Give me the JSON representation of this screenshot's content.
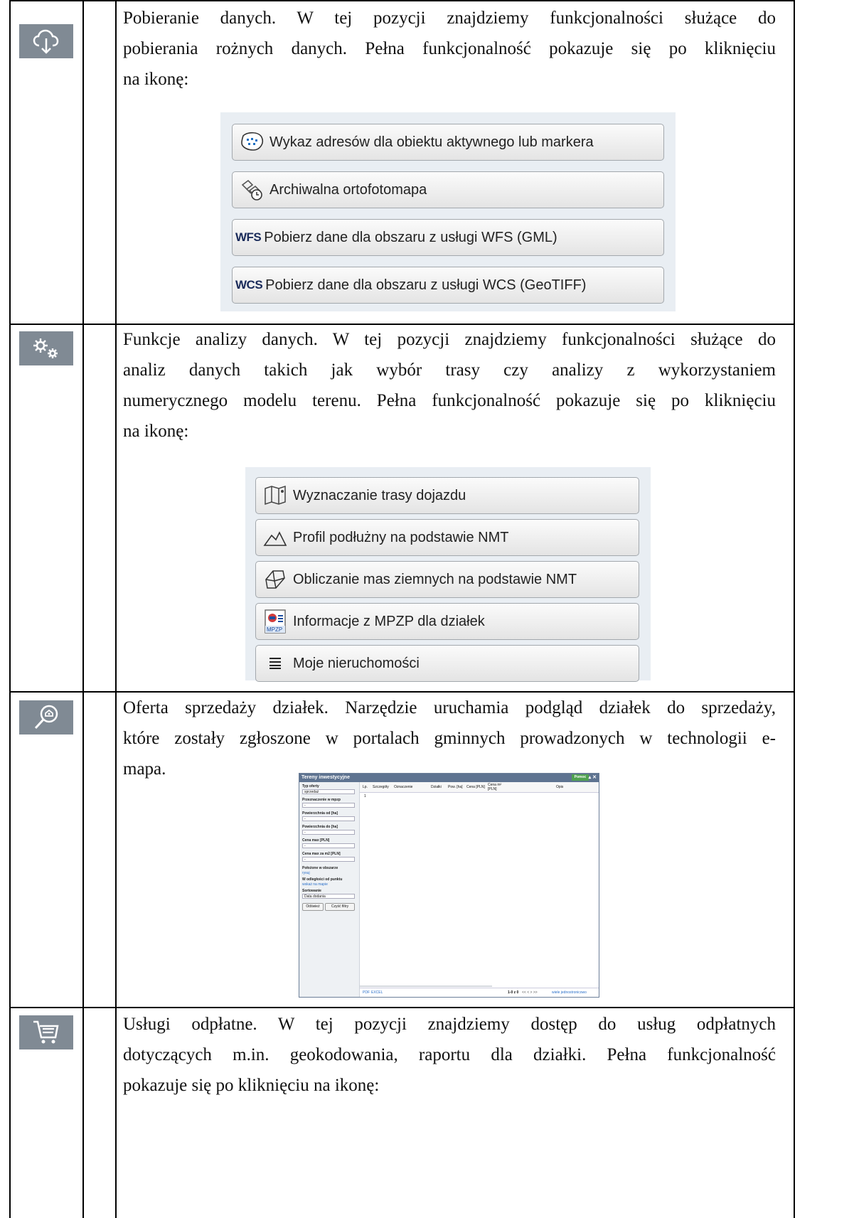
{
  "rows": [
    {
      "icon": "cloud-download-icon",
      "lines": [
        "Pobieranie danych. W tej pozycji znajdziemy funkcjonalności służące do",
        "pobierania rożnych danych. Pełna funkcjonalność pokazuje się po kliknięciu",
        "na ikonę:"
      ],
      "buttons": [
        {
          "icon": "address-list-icon",
          "label": "Wykaz adresów dla obiektu aktywnego lub markera"
        },
        {
          "icon": "archive-orthophoto-icon",
          "label": "Archiwalna ortofotomapa"
        },
        {
          "icon_text": "WFS",
          "label": "Pobierz dane dla obszaru z usługi WFS (GML)"
        },
        {
          "icon_text": "WCS",
          "label": "Pobierz dane dla obszaru z usługi WCS (GeoTIFF)"
        }
      ]
    },
    {
      "icon": "gears-icon",
      "lines": [
        "Funkcje analizy danych. W tej pozycji znajdziemy funkcjonalności służące do",
        "analiz danych takich jak wybór trasy czy analizy z wykorzystaniem",
        "numerycznego modelu terenu. Pełna funkcjonalność pokazuje się po kliknięciu",
        "na ikonę:"
      ],
      "buttons": [
        {
          "icon": "route-map-icon",
          "label": "Wyznaczanie trasy dojazdu"
        },
        {
          "icon": "profile-mountain-icon",
          "label": "Profil podłużny na podstawie NMT"
        },
        {
          "icon": "earthwork-volume-icon",
          "label": "Obliczanie mas ziemnych na podstawie NMT"
        },
        {
          "icon": "mpzp-document-icon",
          "label": "Informacje z MPZP dla działek"
        },
        {
          "icon": "list-lines-icon",
          "label": "Moje nieruchomości"
        }
      ]
    },
    {
      "icon": "property-search-icon",
      "lines": [
        "Oferta sprzedaży działek. Narzędzie uruchamia podgląd działek do sprzedaży,",
        "które zostały zgłoszone w portalach gminnych prowadzonych w technologii e-",
        "mapa."
      ]
    },
    {
      "icon": "cart-icon",
      "lines": [
        "Usługi odpłatne. W tej pozycji znajdziemy dostęp do usług odpłatnych",
        "dotyczących m.in. geokodowania, raportu dla działki. Pełna funkcjonalność",
        "pokazuje się po kliknięciu na ikonę:"
      ]
    }
  ],
  "window": {
    "title": "Tereny inwestycyjne",
    "help": "Pomoc",
    "filters": [
      {
        "label": "Typ oferty",
        "value": "sprzedaż"
      },
      {
        "label": "Przeznaczenie w mpzp",
        "value": "-"
      },
      {
        "label": "Powierzchnia od [ha]",
        "value": "-"
      },
      {
        "label": "Powierzchnia do [ha]",
        "value": "-"
      },
      {
        "label": "Cena max [PLN]",
        "value": "-"
      },
      {
        "label": "Cena max za m2 [PLN]",
        "value": "-"
      }
    ],
    "area_label": "Położone w obszarze",
    "area_link": "rysuj",
    "distance_label": "W odległości od punktu",
    "distance_link": "wskaż na mapie",
    "sort_label": "Sortowanie",
    "sort_value": "Data dodania",
    "refresh_button": "Odśwież",
    "clear_button": "Czyść filtry",
    "columns": [
      "Lp.",
      "Szczegóły",
      "Oznaczenie",
      "Działki",
      "Pow. [ha]",
      "Cena [PLN]",
      "Cena m² [PLN]",
      "Opis"
    ],
    "first_row": "1",
    "export_pdf": "PDF",
    "export_excel": "EXCEL",
    "pager": "1-0 z 0",
    "pager_nav": "<< < > >>",
    "units_link": "wiele jednostronicowo"
  }
}
